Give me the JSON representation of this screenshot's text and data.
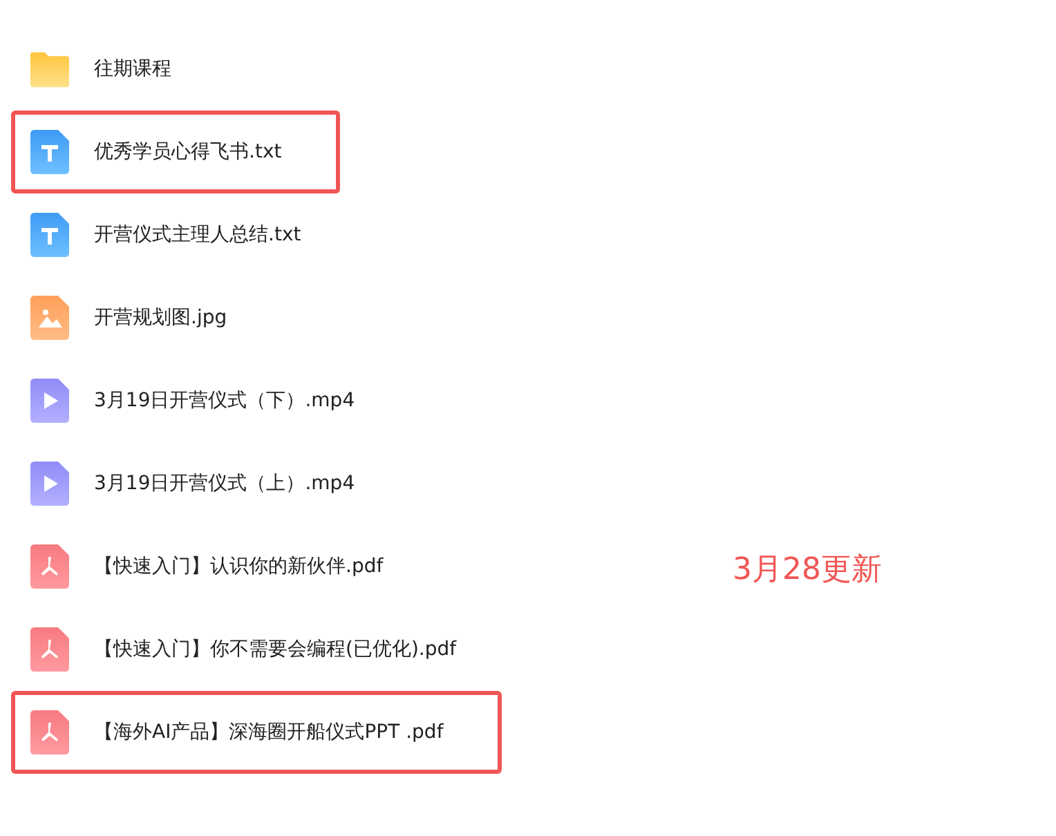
{
  "files": [
    {
      "kind": "folder",
      "name": "往期课程",
      "highlighted": false
    },
    {
      "kind": "text",
      "name": "优秀学员心得飞书.txt",
      "highlighted": true
    },
    {
      "kind": "text",
      "name": "开营仪式主理人总结.txt",
      "highlighted": false
    },
    {
      "kind": "image",
      "name": "开营规划图.jpg",
      "highlighted": false
    },
    {
      "kind": "video",
      "name": "3月19日开营仪式（下）.mp4",
      "highlighted": false
    },
    {
      "kind": "video",
      "name": "3月19日开营仪式（上）.mp4",
      "highlighted": false
    },
    {
      "kind": "pdf",
      "name": "【快速入门】认识你的新伙伴.pdf",
      "highlighted": false
    },
    {
      "kind": "pdf",
      "name": "【快速入门】你不需要会编程(已优化).pdf",
      "highlighted": false
    },
    {
      "kind": "pdf",
      "name": "【海外AI产品】深海圈开船仪式PPT .pdf",
      "highlighted": true
    }
  ],
  "annotation": "3月28更新"
}
